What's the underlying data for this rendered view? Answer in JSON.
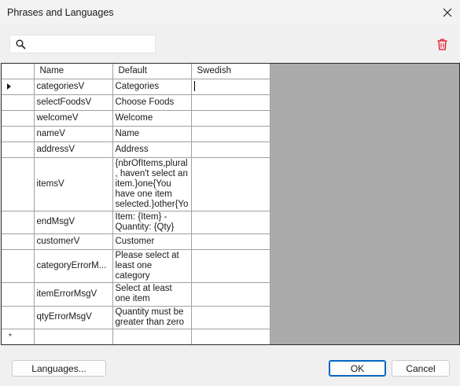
{
  "window": {
    "title": "Phrases and Languages"
  },
  "search": {
    "placeholder": "",
    "value": ""
  },
  "grid": {
    "columns": [
      "Name",
      "Default",
      "Swedish"
    ],
    "rows": [
      {
        "name": "categoriesV",
        "default": "Categories",
        "swedish": ""
      },
      {
        "name": "selectFoodsV",
        "default": "Choose Foods",
        "swedish": ""
      },
      {
        "name": "welcomeV",
        "default": "Welcome",
        "swedish": ""
      },
      {
        "name": "nameV",
        "default": "Name",
        "swedish": ""
      },
      {
        "name": "addressV",
        "default": "Address",
        "swedish": ""
      },
      {
        "name": "itemsV",
        "default": "{nbrOfItems,plural, haven't select an item.}one{You have one item selected.}other{You",
        "swedish": ""
      },
      {
        "name": "endMsgV",
        "default": "Item: {Item} - Quantity: {Qty}",
        "swedish": ""
      },
      {
        "name": "customerV",
        "default": "Customer",
        "swedish": ""
      },
      {
        "name": "categoryErrorM...",
        "default": "Please select at least one category",
        "swedish": ""
      },
      {
        "name": "itemErrorMsgV",
        "default": "Select at least one item",
        "swedish": ""
      },
      {
        "name": "qtyErrorMsgV",
        "default": "Quantity must be greater than zero",
        "swedish": ""
      }
    ],
    "new_row_marker": "*"
  },
  "buttons": {
    "languages": "Languages...",
    "ok": "OK",
    "cancel": "Cancel"
  },
  "colors": {
    "delete_icon": "#e81123",
    "primary_border": "#0067c0",
    "grid_background": "#ababab"
  },
  "icons": {
    "close": "close-icon",
    "search": "search-icon",
    "delete": "trash-icon",
    "current_row": "row-pointer-icon"
  }
}
